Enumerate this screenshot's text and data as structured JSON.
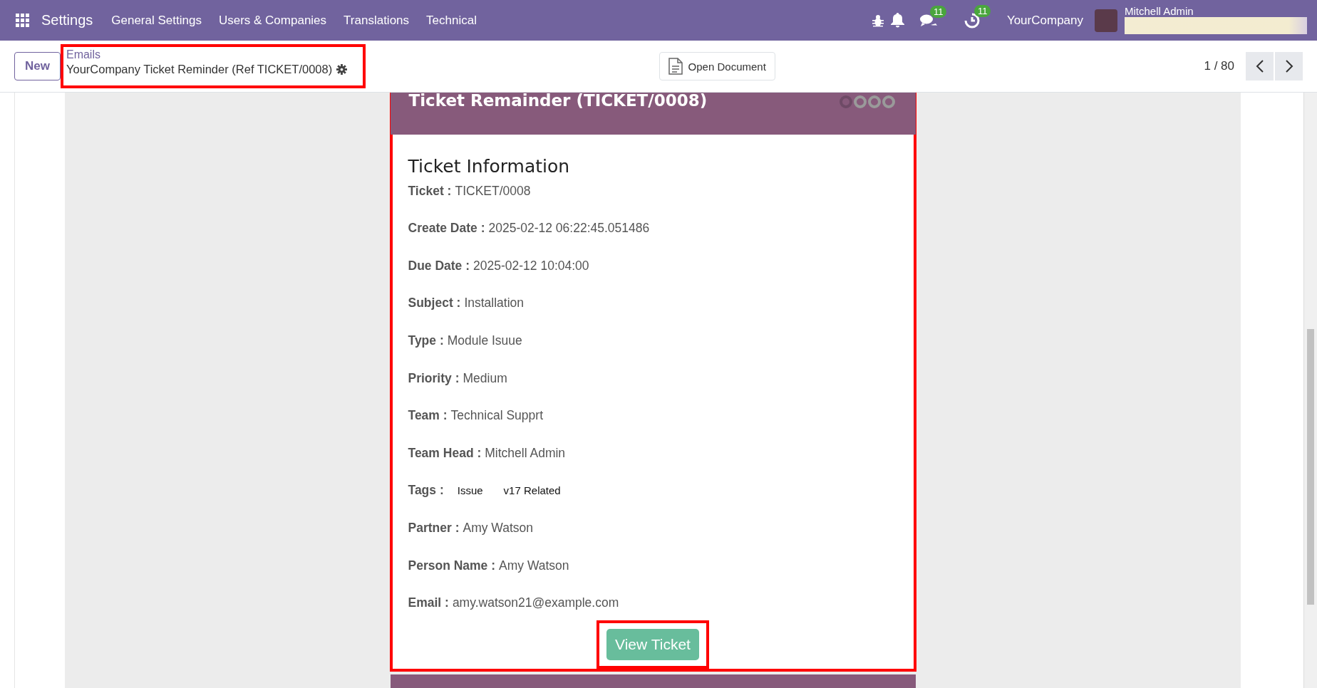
{
  "navbar": {
    "app_title": "Settings",
    "menu": [
      "General Settings",
      "Users & Companies",
      "Translations",
      "Technical"
    ],
    "chat_count": "11",
    "activity_count": "11",
    "company": "YourCompany",
    "user_name": "Mitchell Admin"
  },
  "control_panel": {
    "new_button": "New",
    "breadcrumb": {
      "parent": "Emails",
      "current": "YourCompany Ticket Reminder (Ref TICKET/0008)"
    },
    "open_document": "Open Document",
    "pager": "1 / 80"
  },
  "email": {
    "title": "Ticket Remainder (TICKET/0008)",
    "heading": "Ticket Information",
    "fields": [
      {
        "kind": "text",
        "label": "Ticket :",
        "value": "TICKET/0008"
      },
      {
        "kind": "text",
        "label": "Create Date :",
        "value": "2025-02-12 06:22:45.051486"
      },
      {
        "kind": "text",
        "label": "Due Date :",
        "value": "2025-02-12 10:04:00"
      },
      {
        "kind": "text",
        "label": "Subject :",
        "value": "Installation"
      },
      {
        "kind": "text",
        "label": "Type :",
        "value": "Module Isuue"
      },
      {
        "kind": "text",
        "label": "Priority :",
        "value": "Medium"
      },
      {
        "kind": "text",
        "label": "Team :",
        "value": "Technical Supprt"
      },
      {
        "kind": "text",
        "label": "Team Head :",
        "value": "Mitchell Admin"
      },
      {
        "kind": "tags",
        "label": "Tags :",
        "tags": [
          "Issue",
          "v17 Related"
        ]
      },
      {
        "kind": "text",
        "label": "Partner :",
        "value": "Amy Watson"
      },
      {
        "kind": "text",
        "label": "Person Name :",
        "value": "Amy Watson"
      },
      {
        "kind": "text",
        "label": "Email :",
        "value": "amy.watson21@example.com"
      }
    ],
    "button": "View Ticket"
  }
}
